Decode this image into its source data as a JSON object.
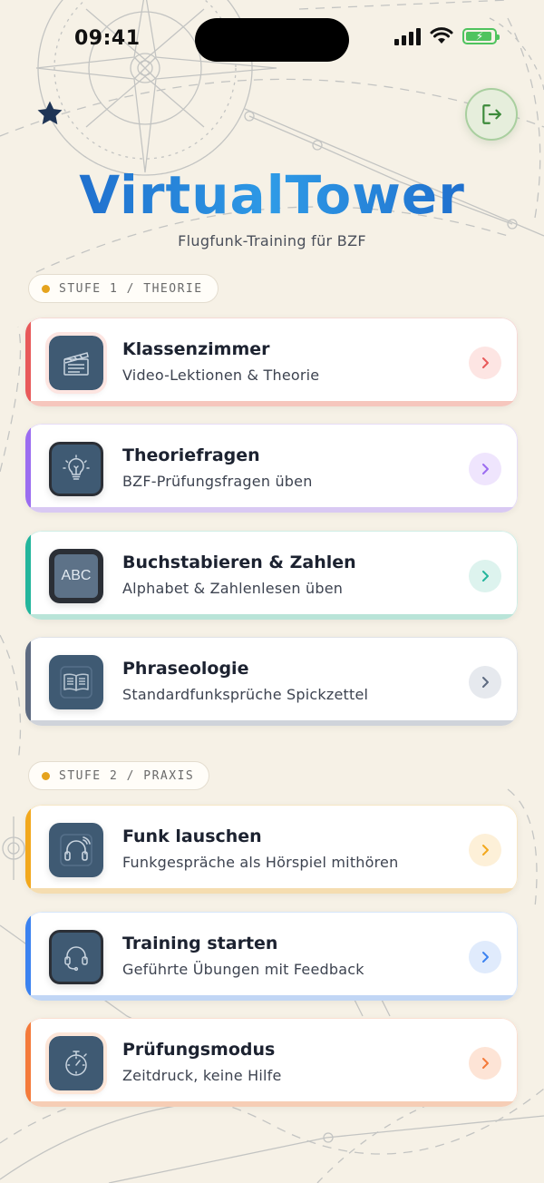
{
  "status_bar": {
    "time": "09:41"
  },
  "app": {
    "title": "VirtualTower",
    "subtitle": "Flugfunk-Training für BZF"
  },
  "sections": [
    {
      "label": "STUFE 1 / THEORIE",
      "cards": [
        {
          "title": "Klassenzimmer",
          "description": "Video-Lektionen & Theorie",
          "icon": "clapperboard-icon",
          "accent": "#e8595a"
        },
        {
          "title": "Theoriefragen",
          "description": "BZF-Prüfungsfragen üben",
          "icon": "lightbulb-icon",
          "accent": "#9b6cf0"
        },
        {
          "title": "Buchstabieren & Zahlen",
          "description": "Alphabet & Zahlenlesen üben",
          "icon": "abc-icon",
          "icon_text": "ABC",
          "accent": "#23b59c"
        },
        {
          "title": "Phraseologie",
          "description": "Standardfunksprüche Spickzettel",
          "icon": "book-icon",
          "accent": "#5d6a80"
        }
      ]
    },
    {
      "label": "STUFE 2 / PRAXIS",
      "cards": [
        {
          "title": "Funk lauschen",
          "description": "Funkgespräche als Hörspiel mithören",
          "icon": "headphones-icon",
          "accent": "#f2a81d"
        },
        {
          "title": "Training starten",
          "description": "Geführte Übungen mit Feedback",
          "icon": "headset-icon",
          "accent": "#3b82f0"
        },
        {
          "title": "Prüfungsmodus",
          "description": "Zeitdruck, keine Hilfe",
          "icon": "stopwatch-icon",
          "accent": "#f47a3a"
        }
      ]
    }
  ],
  "colors": {
    "background": "#f6f1e6",
    "brand_blue": "#1d6fd1",
    "section_dot": "#e5a31d",
    "logout_green": "#3c8a3a"
  },
  "icons": {
    "favorite": "star-icon",
    "logout": "logout-icon",
    "chevron": "chevron-right-icon"
  }
}
